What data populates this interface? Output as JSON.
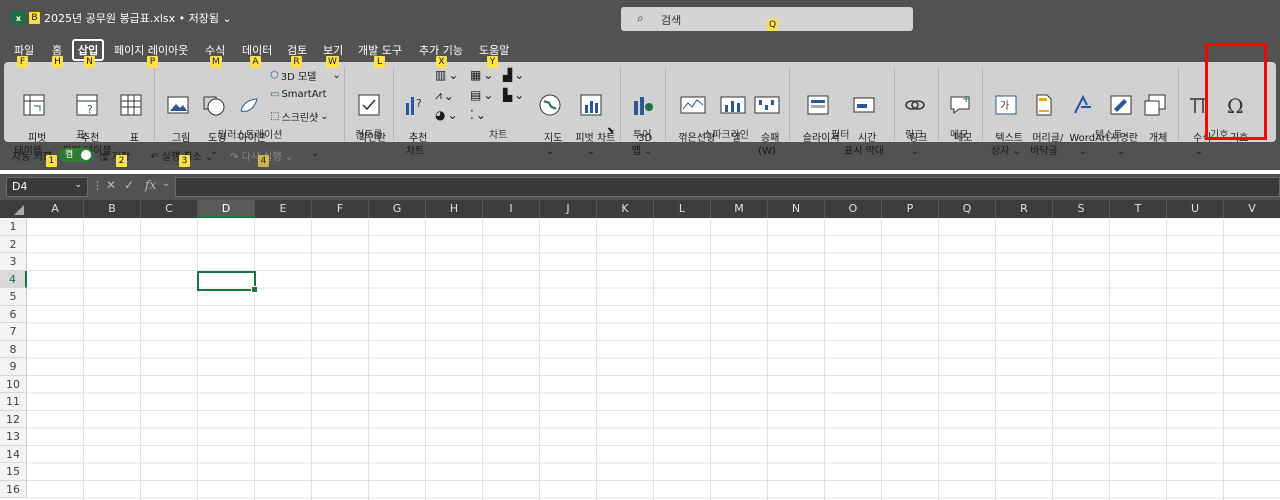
{
  "window": {
    "app_badge": "x",
    "qat_keytip": "B",
    "title": "2025년 공무원 봉급표.xlsx • 저장됨",
    "title_chevron": "⌄"
  },
  "search": {
    "placeholder": "검색",
    "keytip": "Q"
  },
  "menu": {
    "tabs": [
      {
        "label": "파일",
        "keytip": "F"
      },
      {
        "label": "홈",
        "keytip": "H"
      },
      {
        "label": "삽입",
        "keytip": "N",
        "active": true
      },
      {
        "label": "페이지 레이아웃",
        "keytip": "P"
      },
      {
        "label": "수식",
        "keytip": "M"
      },
      {
        "label": "데이터",
        "keytip": "A"
      },
      {
        "label": "검토",
        "keytip": "R"
      },
      {
        "label": "보기",
        "keytip": "W"
      },
      {
        "label": "개발 도구",
        "keytip": "L"
      },
      {
        "label": "추가 기능",
        "keytip": "X"
      },
      {
        "label": "도움말",
        "keytip": "Y"
      }
    ]
  },
  "ribbon": {
    "groups": {
      "table": "표",
      "illustrations": "일러스트레이션",
      "controls": "컨트롤",
      "charts": "차트",
      "tours": "투어",
      "sparklines": "스파크라인",
      "filters": "필터",
      "links": "링크",
      "comments": "메모",
      "text": "텍스트",
      "symbols": "기호"
    },
    "buttons": {
      "pivot_table": "피벗\n테이블 ⌄",
      "recommended_pivot": "추천\n피벗 테이블",
      "table": "표",
      "picture": "그림\n⌄",
      "shapes": "도형\n⌄",
      "icons": "아이콘",
      "model3d": "3D 모델",
      "smartart": "SmartArt",
      "screenshot": "스크린샷",
      "checkbox": "확인란",
      "recommended_chart": "추천\n차트",
      "maps": "지도\n⌄",
      "pivot_chart": "피벗 차트\n⌄",
      "map3d": "3D\n맵 ⌄",
      "sparkline_line": "꺾은선형",
      "sparkline_column": "열",
      "sparkline_winloss": "승패\n(W)",
      "slicer": "슬라이서",
      "timeline": "시간\n표시 막대",
      "link": "링크\n⌄",
      "comment": "메모",
      "textbox": "텍스트\n상자 ⌄",
      "header_footer": "머리글/\n바닥글",
      "wordart": "WordArt\n⌄",
      "signature_line": "서명란\n⌄",
      "object": "개체",
      "equation": "수식\n⌄",
      "symbol": "기호"
    }
  },
  "quick_access": {
    "autosave_label": "자동 저장",
    "autosave_state": "켬",
    "save": "저장",
    "undo": "실행 취소",
    "redo": "다시 실행",
    "keytips": [
      "1",
      "2",
      "3",
      "4"
    ]
  },
  "formula_bar": {
    "name_box": "D4",
    "fx": "fx"
  },
  "sheet": {
    "columns": [
      "A",
      "B",
      "C",
      "D",
      "E",
      "F",
      "G",
      "H",
      "I",
      "J",
      "K",
      "L",
      "M",
      "N",
      "O",
      "P",
      "Q",
      "R",
      "S",
      "T",
      "U",
      "V"
    ],
    "rows": [
      "1",
      "2",
      "3",
      "4",
      "5",
      "6",
      "7",
      "8",
      "9",
      "10",
      "11",
      "12",
      "13",
      "14",
      "15",
      "16"
    ],
    "active_cell": "D4",
    "selected_column": "D",
    "selected_row": "4"
  },
  "colors": {
    "accent": "#1e7145",
    "highlight_box": "#ff0000",
    "keytip": "#fde04a"
  }
}
